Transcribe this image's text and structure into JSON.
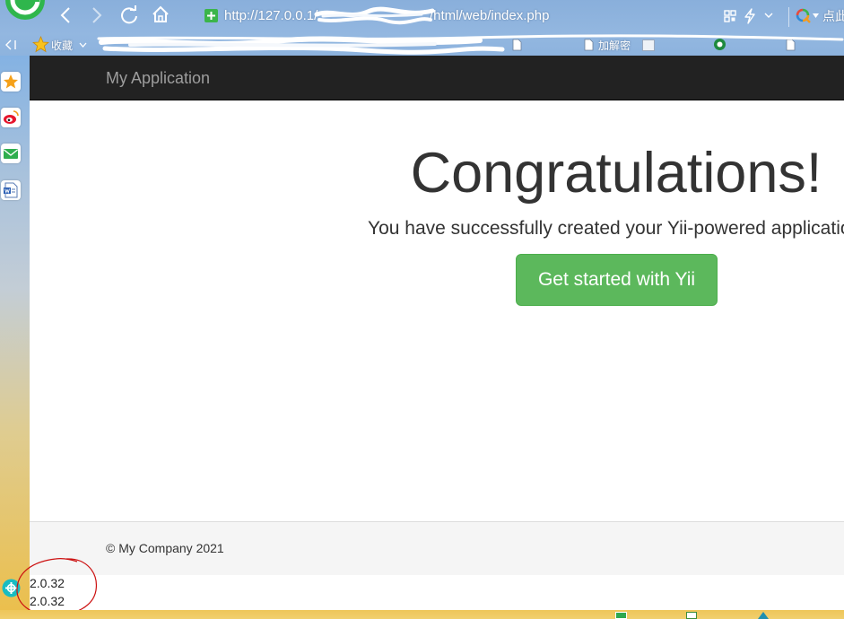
{
  "browser": {
    "url_prefix": "http://127.0.0.1/",
    "url_suffix": "/html/web/index.php",
    "search_hint": "点此",
    "bookmarks_label": "收藏",
    "bookmark_item": "加解密"
  },
  "app": {
    "brand": "My Application",
    "heading": "Congratulations!",
    "lead": "You have successfully created your Yii-powered application.",
    "cta_label": "Get started with Yii",
    "footer_text": "© My Company 2021",
    "version_lines": [
      "2.0.32",
      "2.0.32"
    ]
  },
  "colors": {
    "chrome_bg": "#8eb3dd",
    "navbar_bg": "#222222",
    "brand_text": "#9d9d9d",
    "cta_bg": "#5cb85c",
    "footer_bg": "#f5f5f5",
    "annotation": "#cc1111"
  }
}
